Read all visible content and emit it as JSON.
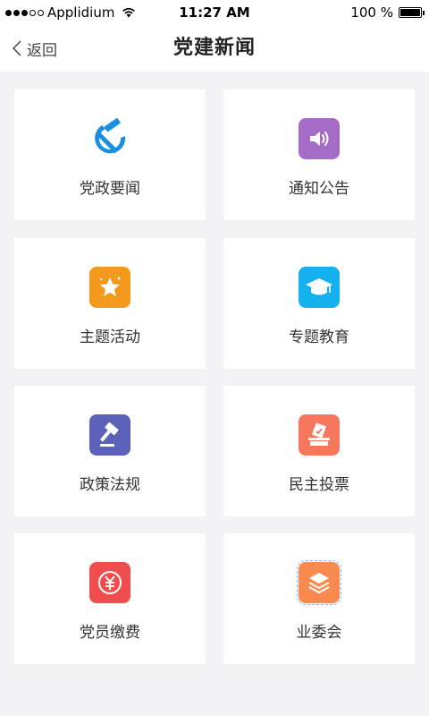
{
  "status_bar": {
    "carrier": "Applidium",
    "time": "11:27 AM",
    "battery": "100 %",
    "battery_level": 1.0,
    "signal_bars_filled": 3,
    "signal_bars_total": 5
  },
  "nav": {
    "back_label": "返回",
    "title": "党建新闻"
  },
  "tiles": [
    {
      "label": "党政要闻",
      "icon": "hammer-sickle-icon",
      "color": "#1a8fe0"
    },
    {
      "label": "通知公告",
      "icon": "speaker-icon",
      "color": "#a46cc6"
    },
    {
      "label": "主题活动",
      "icon": "star-icon",
      "color": "#f39a1e"
    },
    {
      "label": "专题教育",
      "icon": "graduation-cap-icon",
      "color": "#15b0ee"
    },
    {
      "label": "政策法规",
      "icon": "gavel-icon",
      "color": "#5b61b9"
    },
    {
      "label": "民主投票",
      "icon": "ballot-box-icon",
      "color": "#f7775e"
    },
    {
      "label": "党员缴费",
      "icon": "yuan-icon",
      "color": "#f04e4e"
    },
    {
      "label": "业委会",
      "icon": "layers-icon",
      "color": "#f88a4f"
    }
  ]
}
